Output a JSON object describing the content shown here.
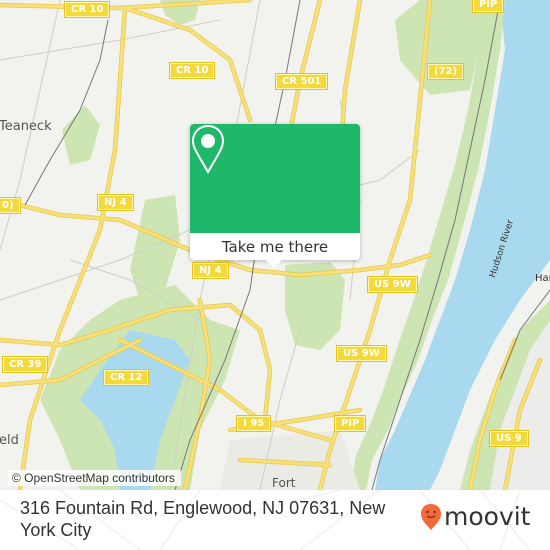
{
  "map": {
    "attribution": "© OpenStreetMap contributors",
    "colors": {
      "land": "#f2f2ee",
      "park": "#cde4b3",
      "water": "#a9d9ee",
      "road": "#f7e07a",
      "road_casing": "#e8c94a",
      "shield_fill": "#f3d93a",
      "rail": "#777777"
    },
    "road_shields": [
      {
        "id": "cr10-top",
        "label": "CR 10"
      },
      {
        "id": "cr10-mid",
        "label": "CR 10"
      },
      {
        "id": "cr501",
        "label": "CR 501"
      },
      {
        "id": "pip-top",
        "label": "PIP"
      },
      {
        "id": "nj72",
        "label": "(72)"
      },
      {
        "id": "nj4-left",
        "label": "NJ 4"
      },
      {
        "id": "nj4-center",
        "label": "NJ 4"
      },
      {
        "id": "cr-left-partial",
        "label": "0)"
      },
      {
        "id": "us9w-upper",
        "label": "US 9W"
      },
      {
        "id": "us9w-mid",
        "label": "US 9W"
      },
      {
        "id": "us9w-lower",
        "label": "US 9W"
      },
      {
        "id": "cr39",
        "label": "CR 39"
      },
      {
        "id": "cr12",
        "label": "CR 12"
      },
      {
        "id": "i95",
        "label": "I 95"
      },
      {
        "id": "pip-bottom",
        "label": "PIP"
      },
      {
        "id": "us9",
        "label": "US 9"
      }
    ],
    "places": [
      {
        "id": "teaneck",
        "label": "Teaneck"
      },
      {
        "id": "ridgefield-partial",
        "label": "eld"
      },
      {
        "id": "fort-lee-partial",
        "label": "Fort"
      },
      {
        "id": "harlem-partial",
        "label": "Harl"
      },
      {
        "id": "hudson-river",
        "label": "Hudson River"
      }
    ]
  },
  "popup": {
    "icon": "location-pin-icon",
    "accent_color": "#1fb86a",
    "button_label": "Take me there"
  },
  "footer": {
    "address": "316 Fountain Rd, Englewood, NJ 07631, New York City",
    "brand": "moovit",
    "brand_color": "#f26a3b"
  }
}
